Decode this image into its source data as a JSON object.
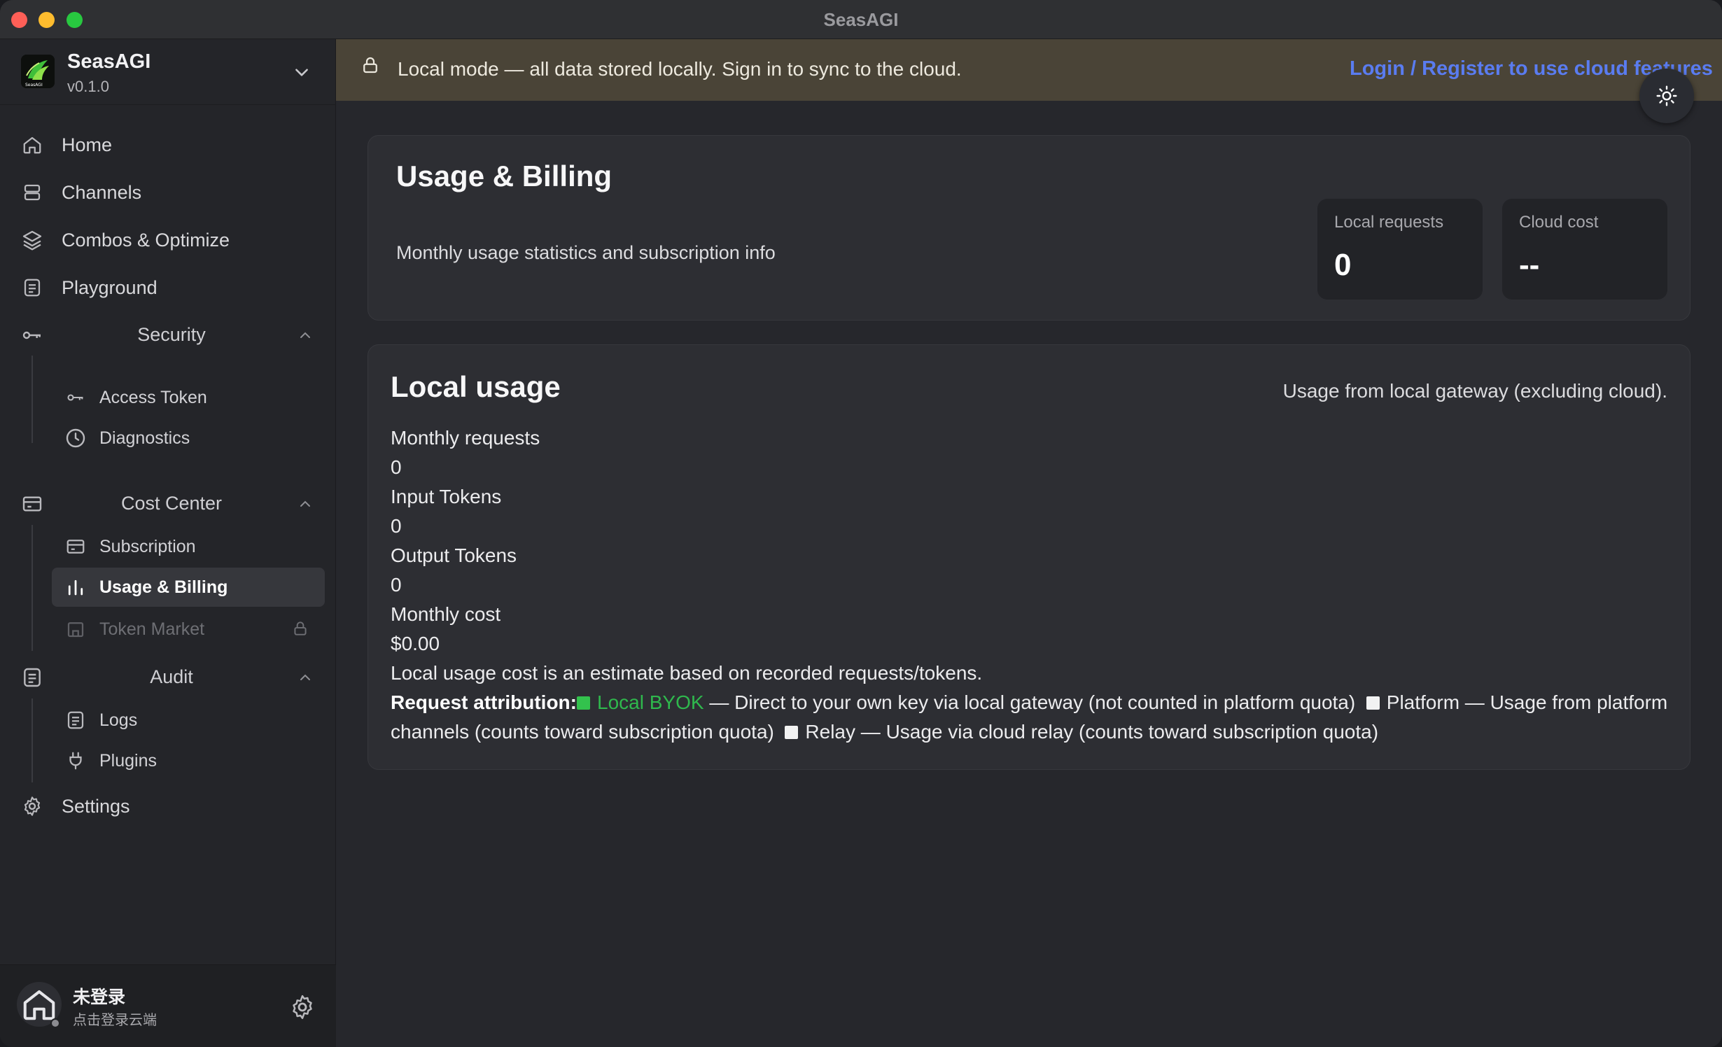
{
  "window": {
    "title": "SeasAGI"
  },
  "brand": {
    "name": "SeasAGI",
    "version": "v0.1.0",
    "logo_text": "SeasAGI"
  },
  "nav": {
    "home": "Home",
    "channels": "Channels",
    "combos": "Combos & Optimize",
    "playground": "Playground",
    "security": {
      "label": "Security",
      "items": [
        "Access Token",
        "Diagnostics"
      ]
    },
    "cost_center": {
      "label": "Cost Center",
      "items": [
        "Subscription",
        "Usage & Billing",
        "Token Market"
      ]
    },
    "audit": {
      "label": "Audit",
      "items": [
        "Logs",
        "Plugins"
      ]
    },
    "settings": "Settings"
  },
  "user": {
    "name": "未登录",
    "subtitle": "点击登录云端"
  },
  "banner": {
    "text": "Local mode — all data stored locally. Sign in to sync to the cloud.",
    "login_link": "Login / Register to use cloud features"
  },
  "billing_card": {
    "title": "Usage & Billing",
    "subtitle": "Monthly usage statistics and subscription info",
    "stats": [
      {
        "label": "Local requests",
        "value": "0"
      },
      {
        "label": "Cloud cost",
        "value": "--"
      }
    ]
  },
  "local_usage": {
    "title": "Local usage",
    "description": "Usage from local gateway (excluding cloud).",
    "monthly_requests_label": "Monthly requests",
    "monthly_requests": "0",
    "input_tokens_label": "Input Tokens",
    "input_tokens": "0",
    "output_tokens_label": "Output Tokens",
    "output_tokens": "0",
    "monthly_cost_label": "Monthly cost",
    "monthly_cost": "$0.00",
    "note": "Local usage cost is an estimate based on recorded requests/tokens.",
    "attribution": {
      "label": "Request attribution:",
      "byok_name": "Local BYOK",
      "byok_desc": "— Direct to your own key via local gateway (not counted in platform quota)",
      "platform": "Platform — Usage from platform channels (counts toward subscription quota)",
      "relay": "Relay — Usage via cloud relay (counts toward subscription quota)"
    }
  },
  "colors": {
    "banner_bg": "#4a4437",
    "link": "#5a7cf0",
    "byok_green": "#2fb84d",
    "close": "#fe5f57",
    "minimize": "#febc2e",
    "maximize": "#28c840"
  }
}
